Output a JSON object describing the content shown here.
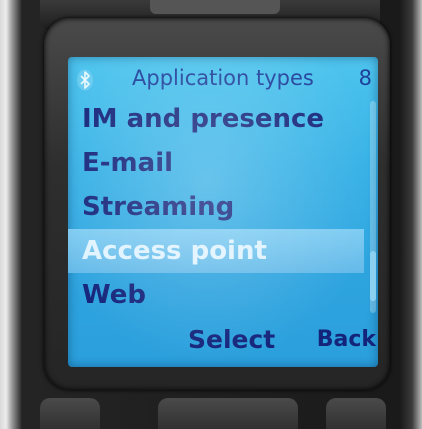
{
  "header": {
    "title": "Application types",
    "count": "8",
    "status_icon": "bluetooth-icon"
  },
  "list": {
    "items": [
      {
        "label": "IM and presence",
        "selected": false
      },
      {
        "label": "E-mail",
        "selected": false
      },
      {
        "label": "Streaming",
        "selected": false
      },
      {
        "label": "Access point",
        "selected": true
      },
      {
        "label": "Web",
        "selected": false
      }
    ]
  },
  "softkeys": {
    "middle": "Select",
    "right": "Back"
  },
  "colors": {
    "screen_background": "#36b1e6",
    "text": "#14247a",
    "highlight_text": "#dff3ff"
  }
}
